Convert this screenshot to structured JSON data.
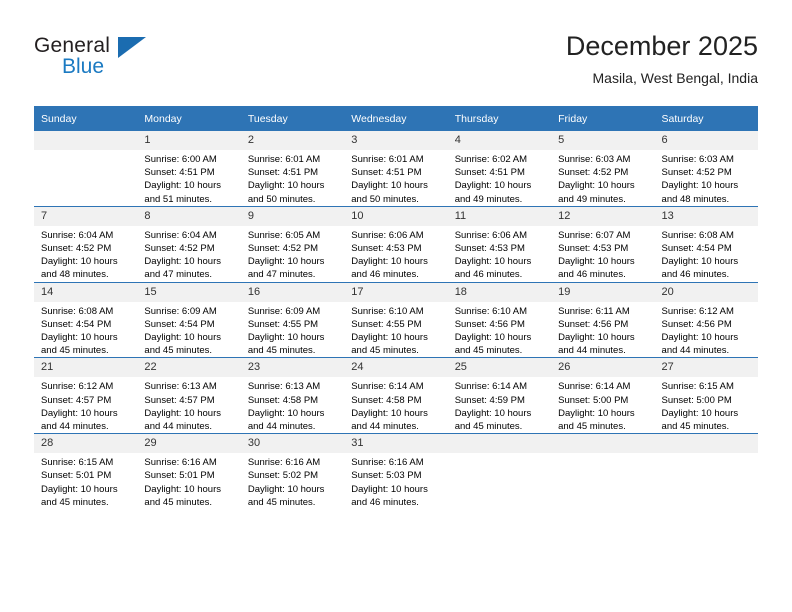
{
  "brand": {
    "name_top": "General",
    "name_bottom": "Blue",
    "accent_color": "#1b7ac2",
    "triangle_color": "#1b6cb0"
  },
  "header": {
    "title": "December 2025",
    "subtitle": "Masila, West Bengal, India"
  },
  "theme": {
    "header_blue": "#2e74b5",
    "daynum_band": "#f1f1f1",
    "text": "#000000"
  },
  "columns": [
    "Sunday",
    "Monday",
    "Tuesday",
    "Wednesday",
    "Thursday",
    "Friday",
    "Saturday"
  ],
  "weeks": [
    [
      {
        "day": "",
        "lines": []
      },
      {
        "day": "1",
        "lines": [
          "Sunrise: 6:00 AM",
          "Sunset: 4:51 PM",
          "Daylight: 10 hours",
          "and 51 minutes."
        ]
      },
      {
        "day": "2",
        "lines": [
          "Sunrise: 6:01 AM",
          "Sunset: 4:51 PM",
          "Daylight: 10 hours",
          "and 50 minutes."
        ]
      },
      {
        "day": "3",
        "lines": [
          "Sunrise: 6:01 AM",
          "Sunset: 4:51 PM",
          "Daylight: 10 hours",
          "and 50 minutes."
        ]
      },
      {
        "day": "4",
        "lines": [
          "Sunrise: 6:02 AM",
          "Sunset: 4:51 PM",
          "Daylight: 10 hours",
          "and 49 minutes."
        ]
      },
      {
        "day": "5",
        "lines": [
          "Sunrise: 6:03 AM",
          "Sunset: 4:52 PM",
          "Daylight: 10 hours",
          "and 49 minutes."
        ]
      },
      {
        "day": "6",
        "lines": [
          "Sunrise: 6:03 AM",
          "Sunset: 4:52 PM",
          "Daylight: 10 hours",
          "and 48 minutes."
        ]
      }
    ],
    [
      {
        "day": "7",
        "lines": [
          "Sunrise: 6:04 AM",
          "Sunset: 4:52 PM",
          "Daylight: 10 hours",
          "and 48 minutes."
        ]
      },
      {
        "day": "8",
        "lines": [
          "Sunrise: 6:04 AM",
          "Sunset: 4:52 PM",
          "Daylight: 10 hours",
          "and 47 minutes."
        ]
      },
      {
        "day": "9",
        "lines": [
          "Sunrise: 6:05 AM",
          "Sunset: 4:52 PM",
          "Daylight: 10 hours",
          "and 47 minutes."
        ]
      },
      {
        "day": "10",
        "lines": [
          "Sunrise: 6:06 AM",
          "Sunset: 4:53 PM",
          "Daylight: 10 hours",
          "and 46 minutes."
        ]
      },
      {
        "day": "11",
        "lines": [
          "Sunrise: 6:06 AM",
          "Sunset: 4:53 PM",
          "Daylight: 10 hours",
          "and 46 minutes."
        ]
      },
      {
        "day": "12",
        "lines": [
          "Sunrise: 6:07 AM",
          "Sunset: 4:53 PM",
          "Daylight: 10 hours",
          "and 46 minutes."
        ]
      },
      {
        "day": "13",
        "lines": [
          "Sunrise: 6:08 AM",
          "Sunset: 4:54 PM",
          "Daylight: 10 hours",
          "and 46 minutes."
        ]
      }
    ],
    [
      {
        "day": "14",
        "lines": [
          "Sunrise: 6:08 AM",
          "Sunset: 4:54 PM",
          "Daylight: 10 hours",
          "and 45 minutes."
        ]
      },
      {
        "day": "15",
        "lines": [
          "Sunrise: 6:09 AM",
          "Sunset: 4:54 PM",
          "Daylight: 10 hours",
          "and 45 minutes."
        ]
      },
      {
        "day": "16",
        "lines": [
          "Sunrise: 6:09 AM",
          "Sunset: 4:55 PM",
          "Daylight: 10 hours",
          "and 45 minutes."
        ]
      },
      {
        "day": "17",
        "lines": [
          "Sunrise: 6:10 AM",
          "Sunset: 4:55 PM",
          "Daylight: 10 hours",
          "and 45 minutes."
        ]
      },
      {
        "day": "18",
        "lines": [
          "Sunrise: 6:10 AM",
          "Sunset: 4:56 PM",
          "Daylight: 10 hours",
          "and 45 minutes."
        ]
      },
      {
        "day": "19",
        "lines": [
          "Sunrise: 6:11 AM",
          "Sunset: 4:56 PM",
          "Daylight: 10 hours",
          "and 44 minutes."
        ]
      },
      {
        "day": "20",
        "lines": [
          "Sunrise: 6:12 AM",
          "Sunset: 4:56 PM",
          "Daylight: 10 hours",
          "and 44 minutes."
        ]
      }
    ],
    [
      {
        "day": "21",
        "lines": [
          "Sunrise: 6:12 AM",
          "Sunset: 4:57 PM",
          "Daylight: 10 hours",
          "and 44 minutes."
        ]
      },
      {
        "day": "22",
        "lines": [
          "Sunrise: 6:13 AM",
          "Sunset: 4:57 PM",
          "Daylight: 10 hours",
          "and 44 minutes."
        ]
      },
      {
        "day": "23",
        "lines": [
          "Sunrise: 6:13 AM",
          "Sunset: 4:58 PM",
          "Daylight: 10 hours",
          "and 44 minutes."
        ]
      },
      {
        "day": "24",
        "lines": [
          "Sunrise: 6:14 AM",
          "Sunset: 4:58 PM",
          "Daylight: 10 hours",
          "and 44 minutes."
        ]
      },
      {
        "day": "25",
        "lines": [
          "Sunrise: 6:14 AM",
          "Sunset: 4:59 PM",
          "Daylight: 10 hours",
          "and 45 minutes."
        ]
      },
      {
        "day": "26",
        "lines": [
          "Sunrise: 6:14 AM",
          "Sunset: 5:00 PM",
          "Daylight: 10 hours",
          "and 45 minutes."
        ]
      },
      {
        "day": "27",
        "lines": [
          "Sunrise: 6:15 AM",
          "Sunset: 5:00 PM",
          "Daylight: 10 hours",
          "and 45 minutes."
        ]
      }
    ],
    [
      {
        "day": "28",
        "lines": [
          "Sunrise: 6:15 AM",
          "Sunset: 5:01 PM",
          "Daylight: 10 hours",
          "and 45 minutes."
        ]
      },
      {
        "day": "29",
        "lines": [
          "Sunrise: 6:16 AM",
          "Sunset: 5:01 PM",
          "Daylight: 10 hours",
          "and 45 minutes."
        ]
      },
      {
        "day": "30",
        "lines": [
          "Sunrise: 6:16 AM",
          "Sunset: 5:02 PM",
          "Daylight: 10 hours",
          "and 45 minutes."
        ]
      },
      {
        "day": "31",
        "lines": [
          "Sunrise: 6:16 AM",
          "Sunset: 5:03 PM",
          "Daylight: 10 hours",
          "and 46 minutes."
        ]
      },
      {
        "day": "",
        "lines": []
      },
      {
        "day": "",
        "lines": []
      },
      {
        "day": "",
        "lines": []
      }
    ]
  ]
}
